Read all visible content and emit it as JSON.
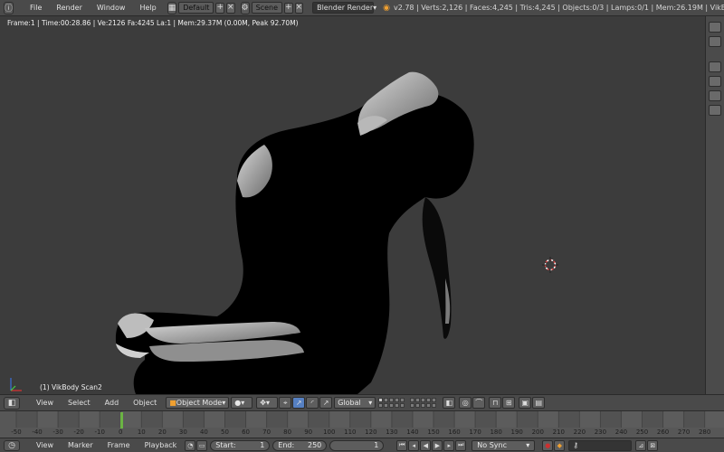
{
  "topbar": {
    "menus": [
      "File",
      "Render",
      "Window",
      "Help"
    ],
    "screen_layout": "Default",
    "scene": "Scene",
    "render_engine": "Blender Render",
    "stats": "v2.78 | Verts:2,126 | Faces:4,245 | Tris:4,245 | Objects:0/3 | Lamps:0/1 | Mem:26.19M | VikBody"
  },
  "viewport": {
    "info": "Frame:1 | Time:00:28.86 | Ve:2126 Fa:4245 La:1 | Mem:29.37M (0.00M, Peak 92.70M)",
    "object_name": "(1) VikBody Scan2"
  },
  "view_header": {
    "menus": [
      "View",
      "Select",
      "Add",
      "Object"
    ],
    "mode": "Object Mode",
    "orientation": "Global"
  },
  "timeline": {
    "ticks": [
      "-50",
      "-40",
      "-30",
      "-20",
      "-10",
      "0",
      "10",
      "20",
      "30",
      "40",
      "50",
      "60",
      "70",
      "80",
      "90",
      "100",
      "110",
      "120",
      "130",
      "140",
      "150",
      "160",
      "170",
      "180",
      "190",
      "200",
      "210",
      "220",
      "230",
      "240",
      "250",
      "260",
      "270",
      "280"
    ],
    "current_frame_marker": 1
  },
  "timeline_header": {
    "menus": [
      "View",
      "Marker",
      "Frame",
      "Playback"
    ],
    "start_label": "Start:",
    "start_value": "1",
    "end_label": "End:",
    "end_value": "250",
    "current_frame": "1",
    "sync": "No Sync"
  },
  "colors": {
    "accent_blue": "#5680c2",
    "frame_green": "#6bb343",
    "record_red": "#cc3030"
  }
}
